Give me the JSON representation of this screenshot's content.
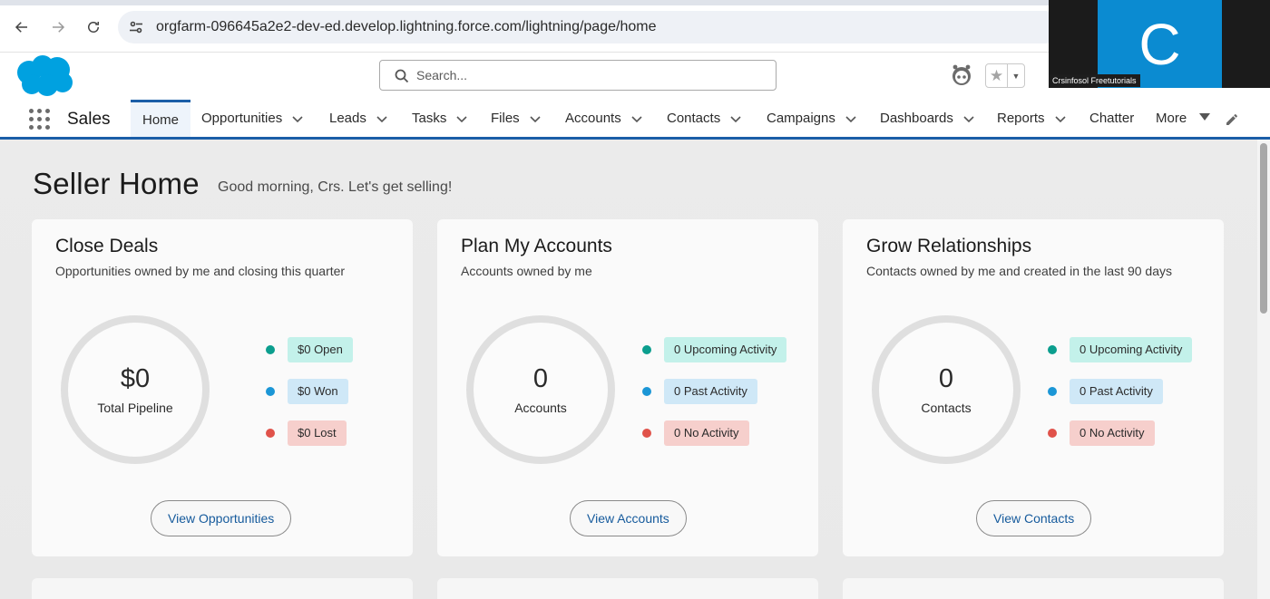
{
  "browser": {
    "url": "orgfarm-096645a2e2-dev-ed.develop.lightning.force.com/lightning/page/home"
  },
  "header": {
    "search_placeholder": "Search..."
  },
  "webcam": {
    "avatar_letter": "C",
    "name_label": "Crsinfosol Freetutorials"
  },
  "nav": {
    "app_name": "Sales",
    "items": [
      {
        "label": "Home",
        "dropdown": false,
        "active": true
      },
      {
        "label": "Opportunities",
        "dropdown": true
      },
      {
        "label": "Leads",
        "dropdown": true
      },
      {
        "label": "Tasks",
        "dropdown": true
      },
      {
        "label": "Files",
        "dropdown": true
      },
      {
        "label": "Accounts",
        "dropdown": true
      },
      {
        "label": "Contacts",
        "dropdown": true
      },
      {
        "label": "Campaigns",
        "dropdown": true
      },
      {
        "label": "Dashboards",
        "dropdown": true
      },
      {
        "label": "Reports",
        "dropdown": true
      },
      {
        "label": "Chatter",
        "dropdown": false
      },
      {
        "label": "More",
        "dropdown": true
      }
    ]
  },
  "page": {
    "title": "Seller Home",
    "greeting": "Good morning, Crs. Let's get selling!"
  },
  "cards": [
    {
      "title": "Close Deals",
      "subtitle": "Opportunities owned by me and closing this quarter",
      "value": "$0",
      "value_label": "Total Pipeline",
      "legend": [
        {
          "label": "$0 Open",
          "dot": "#0b9e8e",
          "bg": "#c3f1ea"
        },
        {
          "label": "$0 Won",
          "dot": "#1b96d6",
          "bg": "#cfe8f7"
        },
        {
          "label": "$0 Lost",
          "dot": "#e0524a",
          "bg": "#f6cfcc"
        }
      ],
      "button": "View Opportunities"
    },
    {
      "title": "Plan My Accounts",
      "subtitle": "Accounts owned by me",
      "value": "0",
      "value_label": "Accounts",
      "legend": [
        {
          "label": "0 Upcoming Activity",
          "dot": "#0b9e8e",
          "bg": "#c3f1ea"
        },
        {
          "label": "0 Past Activity",
          "dot": "#1b96d6",
          "bg": "#cfe8f7"
        },
        {
          "label": "0 No Activity",
          "dot": "#e0524a",
          "bg": "#f6cfcc"
        }
      ],
      "button": "View Accounts"
    },
    {
      "title": "Grow Relationships",
      "subtitle": "Contacts owned by me and created in the last 90 days",
      "value": "0",
      "value_label": "Contacts",
      "legend": [
        {
          "label": "0 Upcoming Activity",
          "dot": "#0b9e8e",
          "bg": "#c3f1ea"
        },
        {
          "label": "0 Past Activity",
          "dot": "#1b96d6",
          "bg": "#cfe8f7"
        },
        {
          "label": "0 No Activity",
          "dot": "#e0524a",
          "bg": "#f6cfcc"
        }
      ],
      "button": "View Contacts"
    }
  ],
  "colors": {
    "brand_blue": "#1b5ea8",
    "salesforce_cloud": "#00a1e0",
    "link": "#155a9c"
  }
}
